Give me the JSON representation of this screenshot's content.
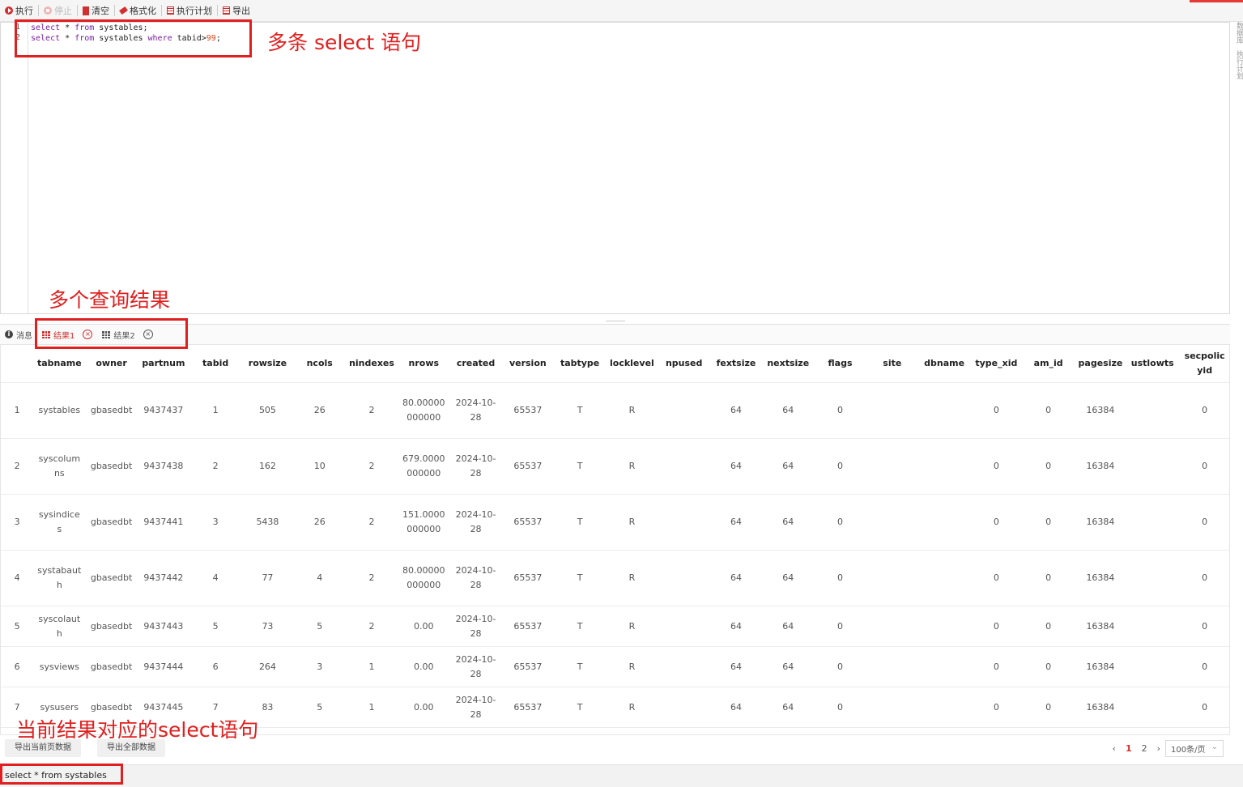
{
  "toolbar": {
    "run": "执行",
    "stop": "停止",
    "clear": "清空",
    "format": "格式化",
    "plan": "执行计划",
    "export": "导出"
  },
  "editor": {
    "line_numbers": [
      "1",
      "2"
    ],
    "lines": [
      [
        {
          "t": "select",
          "k": "kw"
        },
        {
          "t": " * ",
          "k": ""
        },
        {
          "t": "from",
          "k": "kw"
        },
        {
          "t": " systables;",
          "k": ""
        }
      ],
      [
        {
          "t": "select",
          "k": "kw"
        },
        {
          "t": " * ",
          "k": ""
        },
        {
          "t": "from",
          "k": "kw"
        },
        {
          "t": " systables ",
          "k": ""
        },
        {
          "t": "where",
          "k": "kw"
        },
        {
          "t": " tabid>",
          "k": ""
        },
        {
          "t": "99",
          "k": "num"
        },
        {
          "t": ";",
          "k": ""
        }
      ]
    ],
    "side_tabs": [
      "数据库",
      "执行计划"
    ]
  },
  "annotations": {
    "multi_select": "多条 select 语句",
    "multi_results": "多个查询结果",
    "current_select": "当前结果对应的select语句"
  },
  "result_tabs": {
    "messages": "消息",
    "tabs": [
      "结果1",
      "结果2"
    ]
  },
  "table": {
    "columns": [
      "",
      "tabname",
      "owner",
      "partnum",
      "tabid",
      "rowsize",
      "ncols",
      "nindexes",
      "nrows",
      "created",
      "version",
      "tabtype",
      "locklevel",
      "npused",
      "fextsize",
      "nextsize",
      "flags",
      "site",
      "dbname",
      "type_xid",
      "am_id",
      "pagesize",
      "ustlowts",
      "secpolicyid"
    ],
    "rows": [
      [
        "1",
        "systables",
        "gbasedbt",
        "9437437",
        "1",
        "505",
        "26",
        "2",
        "80.00000000000",
        "2024-10-28",
        "65537",
        "T",
        "R",
        "",
        "64",
        "64",
        "0",
        "",
        "",
        "0",
        "0",
        "16384",
        "",
        "0"
      ],
      [
        "2",
        "syscolumns",
        "gbasedbt",
        "9437438",
        "2",
        "162",
        "10",
        "2",
        "679.0000000000",
        "2024-10-28",
        "65537",
        "T",
        "R",
        "",
        "64",
        "64",
        "0",
        "",
        "",
        "0",
        "0",
        "16384",
        "",
        "0"
      ],
      [
        "3",
        "sysindices",
        "gbasedbt",
        "9437441",
        "3",
        "5438",
        "26",
        "2",
        "151.0000000000",
        "2024-10-28",
        "65537",
        "T",
        "R",
        "",
        "64",
        "64",
        "0",
        "",
        "",
        "0",
        "0",
        "16384",
        "",
        "0"
      ],
      [
        "4",
        "systabauth",
        "gbasedbt",
        "9437442",
        "4",
        "77",
        "4",
        "2",
        "80.00000000000",
        "2024-10-28",
        "65537",
        "T",
        "R",
        "",
        "64",
        "64",
        "0",
        "",
        "",
        "0",
        "0",
        "16384",
        "",
        "0"
      ],
      [
        "5",
        "syscolauth",
        "gbasedbt",
        "9437443",
        "5",
        "73",
        "5",
        "2",
        "0.00",
        "2024-10-28",
        "65537",
        "T",
        "R",
        "",
        "64",
        "64",
        "0",
        "",
        "",
        "0",
        "0",
        "16384",
        "",
        "0"
      ],
      [
        "6",
        "sysviews",
        "gbasedbt",
        "9437444",
        "6",
        "264",
        "3",
        "1",
        "0.00",
        "2024-10-28",
        "65537",
        "T",
        "R",
        "",
        "64",
        "64",
        "0",
        "",
        "",
        "0",
        "0",
        "16384",
        "",
        "0"
      ],
      [
        "7",
        "sysusers",
        "gbasedbt",
        "9437445",
        "7",
        "83",
        "5",
        "1",
        "0.00",
        "2024-10-28",
        "65537",
        "T",
        "R",
        "",
        "64",
        "64",
        "0",
        "",
        "",
        "0",
        "0",
        "16384",
        "",
        "0"
      ]
    ]
  },
  "footer": {
    "export_page": "导出当前页数据",
    "export_all": "导出全部数据",
    "prev": "‹",
    "pages": [
      "1",
      "2"
    ],
    "current_page": "1",
    "next": "›",
    "page_size": "100条/页"
  },
  "status": {
    "sql": "select * from systables"
  }
}
